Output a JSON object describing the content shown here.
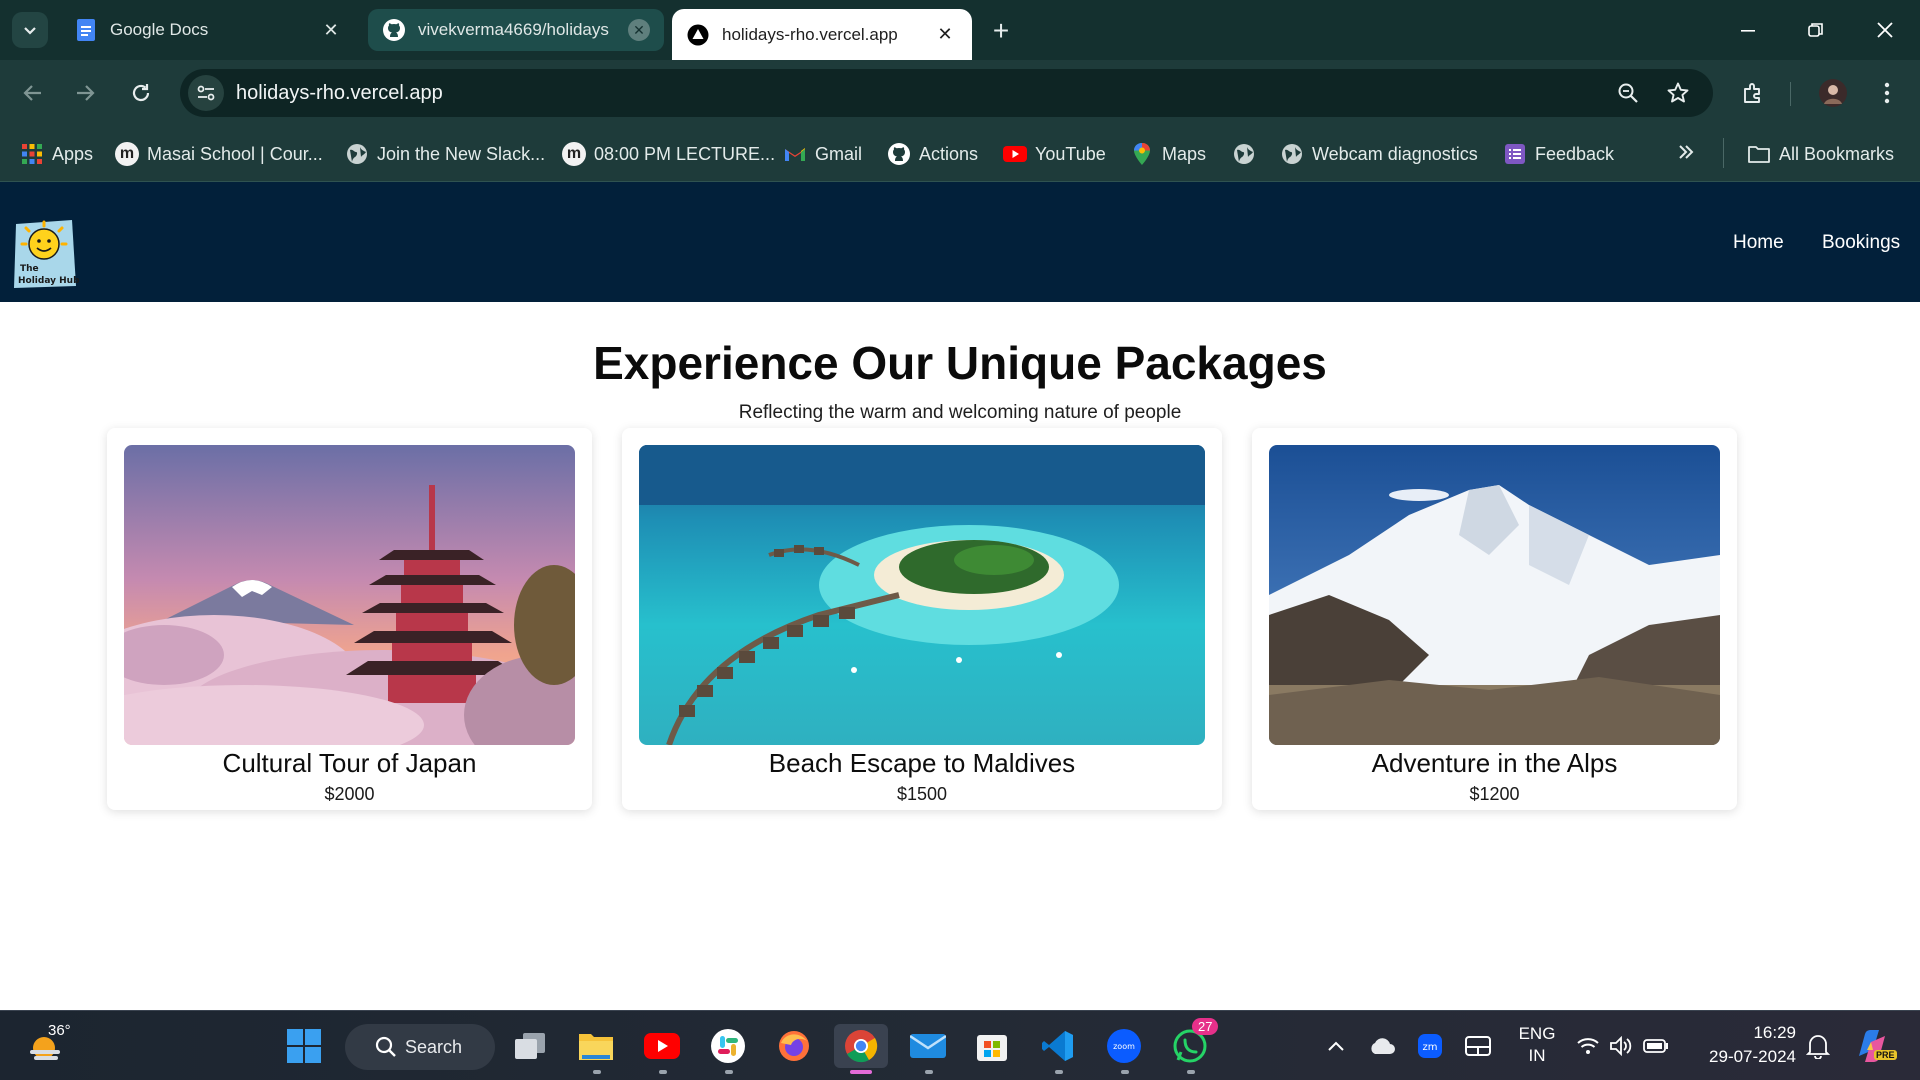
{
  "browser": {
    "tabs": [
      {
        "title": "Google Docs",
        "icon": "google-docs-icon"
      },
      {
        "title": "vivekverma4669/holidays",
        "icon": "github-icon"
      },
      {
        "title": "holidays-rho.vercel.app",
        "icon": "vercel-icon",
        "active": true
      }
    ],
    "url": "holidays-rho.vercel.app",
    "bookmarks": [
      {
        "label": "Apps",
        "icon": "apps-grid-icon"
      },
      {
        "label": "Masai School | Cour...",
        "icon": "masai-icon"
      },
      {
        "label": "Join the New Slack...",
        "icon": "globe-icon"
      },
      {
        "label": "08:00 PM LECTURE...",
        "icon": "masai-icon"
      },
      {
        "label": "Gmail",
        "icon": "gmail-icon"
      },
      {
        "label": "Actions",
        "icon": "github-icon"
      },
      {
        "label": "YouTube",
        "icon": "youtube-icon"
      },
      {
        "label": "Maps",
        "icon": "maps-icon"
      },
      {
        "label": "",
        "icon": "globe-icon"
      },
      {
        "label": "Webcam diagnostics",
        "icon": "globe-icon"
      },
      {
        "label": "Feedback",
        "icon": "feedback-icon"
      }
    ],
    "all_bookmarks": "All Bookmarks"
  },
  "site": {
    "logo_text_line1": "The",
    "logo_text_line2": "Holiday Hub",
    "nav": {
      "home": "Home",
      "bookings": "Bookings"
    },
    "headline": "Experience Our Unique Packages",
    "subline": "Reflecting the warm and welcoming nature of people",
    "packages": [
      {
        "title": "Cultural Tour of Japan",
        "price": "$2000"
      },
      {
        "title": "Beach Escape to Maldives",
        "price": "$1500"
      },
      {
        "title": "Adventure in the Alps",
        "price": "$1200"
      }
    ]
  },
  "taskbar": {
    "weather_temp": "36°",
    "search_label": "Search",
    "whatsapp_badge": "27",
    "language": "ENG",
    "region": "IN",
    "time": "16:29",
    "date": "29-07-2024",
    "copilot_badge": "PRE"
  },
  "colors": {
    "site_header_bg": "#02203a",
    "chrome_bg": "#14302f",
    "toolbar_bg": "#1e3b3a"
  }
}
